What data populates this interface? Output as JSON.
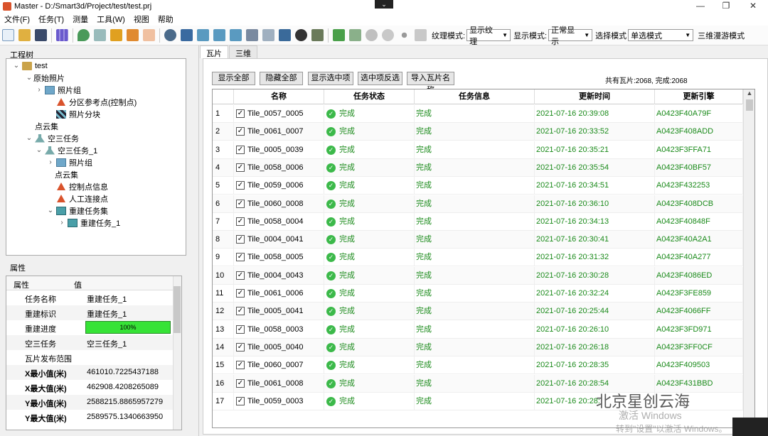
{
  "window": {
    "title": "Master - D:/Smart3d/Project/test/test.prj",
    "dropdown_glyph": "⌄",
    "minimize": "—",
    "maximize": "❐",
    "close": "✕"
  },
  "menubar": [
    "文件(F)",
    "任务(T)",
    "测量",
    "工具(W)",
    "视图",
    "帮助"
  ],
  "toolbar": {
    "texture_label": "纹理模式:",
    "texture_value": "显示纹理",
    "display_label": "显示模式:",
    "display_value": "正常显示",
    "select_label": "选择模式",
    "select_value": "单选模式",
    "roam_label": "三维漫游模式"
  },
  "left": {
    "tree_title": "工程树",
    "tree": [
      {
        "label": "test",
        "icon": "folder-icon",
        "exp": "⌄"
      },
      {
        "label": "原始照片",
        "icon": "",
        "exp": "⌄"
      },
      {
        "label": "照片组",
        "icon": "photo-group-icon",
        "exp": "›"
      },
      {
        "label": "分区参考点(控制点)",
        "icon": "warning-triangle-icon",
        "exp": ""
      },
      {
        "label": "照片分块",
        "icon": "grid-block-icon",
        "exp": ""
      },
      {
        "label": "点云集",
        "icon": "",
        "exp": ""
      },
      {
        "label": "空三任务",
        "icon": "flask-icon",
        "exp": "⌄"
      },
      {
        "label": "空三任务_1",
        "icon": "flask-icon",
        "exp": "⌄"
      },
      {
        "label": "照片组",
        "icon": "photo-group-icon",
        "exp": "›"
      },
      {
        "label": "点云集",
        "icon": "",
        "exp": ""
      },
      {
        "label": "控制点信息",
        "icon": "warning-triangle-icon",
        "exp": ""
      },
      {
        "label": "人工连接点",
        "icon": "warning-triangle-icon",
        "exp": ""
      },
      {
        "label": "重建任务集",
        "icon": "box-icon",
        "exp": "⌄"
      },
      {
        "label": "重建任务_1",
        "icon": "box-icon",
        "exp": "›"
      }
    ],
    "props_title": "属性",
    "props_header": {
      "key": "属性",
      "value": "值"
    },
    "props": [
      {
        "key": "任务名称",
        "value": "重建任务_1",
        "bold": false
      },
      {
        "key": "重建标识",
        "value": "重建任务_1",
        "bold": false
      },
      {
        "key": "重建进度",
        "value": "",
        "bold": false,
        "progress": "100%",
        "progress_fraction": 1.0
      },
      {
        "key": "空三任务",
        "value": "空三任务_1",
        "bold": false
      },
      {
        "key": "瓦片发布范围",
        "value": "",
        "bold": false
      },
      {
        "key": "X最小值(米)",
        "value": "461010.7225437188",
        "bold": true
      },
      {
        "key": "X最大值(米)",
        "value": "462908.4208265089",
        "bold": true
      },
      {
        "key": "Y最小值(米)",
        "value": "2588215.8865957279",
        "bold": true
      },
      {
        "key": "Y最大值(米)",
        "value": "2589575.1340663950",
        "bold": true
      }
    ]
  },
  "right": {
    "tabs": [
      "瓦片",
      "三维"
    ],
    "buttons": [
      "显示全部",
      "隐藏全部",
      "显示选中项",
      "选中项反选",
      "导入瓦片名称"
    ],
    "stats": "共有瓦片:2068, 完成:2068",
    "columns": [
      "",
      "名称",
      "任务状态",
      "任务信息",
      "更新时间",
      "更新引擎"
    ],
    "rows": [
      {
        "n": "1",
        "name": "Tile_0057_0005",
        "status": "完成",
        "info": "完成",
        "time": "2021-07-16 20:39:08",
        "engine": "A0423F40A79F"
      },
      {
        "n": "2",
        "name": "Tile_0061_0007",
        "status": "完成",
        "info": "完成",
        "time": "2021-07-16 20:33:52",
        "engine": "A0423F408ADD"
      },
      {
        "n": "3",
        "name": "Tile_0005_0039",
        "status": "完成",
        "info": "完成",
        "time": "2021-07-16 20:35:21",
        "engine": "A0423F3FFA71"
      },
      {
        "n": "4",
        "name": "Tile_0058_0006",
        "status": "完成",
        "info": "完成",
        "time": "2021-07-16 20:35:54",
        "engine": "A0423F40BF57"
      },
      {
        "n": "5",
        "name": "Tile_0059_0006",
        "status": "完成",
        "info": "完成",
        "time": "2021-07-16 20:34:51",
        "engine": "A0423F432253"
      },
      {
        "n": "6",
        "name": "Tile_0060_0008",
        "status": "完成",
        "info": "完成",
        "time": "2021-07-16 20:36:10",
        "engine": "A0423F408DCB"
      },
      {
        "n": "7",
        "name": "Tile_0058_0004",
        "status": "完成",
        "info": "完成",
        "time": "2021-07-16 20:34:13",
        "engine": "A0423F40848F"
      },
      {
        "n": "8",
        "name": "Tile_0004_0041",
        "status": "完成",
        "info": "完成",
        "time": "2021-07-16 20:30:41",
        "engine": "A0423F40A2A1"
      },
      {
        "n": "9",
        "name": "Tile_0058_0005",
        "status": "完成",
        "info": "完成",
        "time": "2021-07-16 20:31:32",
        "engine": "A0423F40A277"
      },
      {
        "n": "10",
        "name": "Tile_0004_0043",
        "status": "完成",
        "info": "完成",
        "time": "2021-07-16 20:30:28",
        "engine": "A0423F4086ED"
      },
      {
        "n": "11",
        "name": "Tile_0061_0006",
        "status": "完成",
        "info": "完成",
        "time": "2021-07-16 20:32:24",
        "engine": "A0423F3FE859"
      },
      {
        "n": "12",
        "name": "Tile_0005_0041",
        "status": "完成",
        "info": "完成",
        "time": "2021-07-16 20:25:44",
        "engine": "A0423F4066FF"
      },
      {
        "n": "13",
        "name": "Tile_0058_0003",
        "status": "完成",
        "info": "完成",
        "time": "2021-07-16 20:26:10",
        "engine": "A0423F3FD971"
      },
      {
        "n": "14",
        "name": "Tile_0005_0040",
        "status": "完成",
        "info": "完成",
        "time": "2021-07-16 20:26:18",
        "engine": "A0423F3FF0CF"
      },
      {
        "n": "15",
        "name": "Tile_0060_0007",
        "status": "完成",
        "info": "完成",
        "time": "2021-07-16 20:28:35",
        "engine": "A0423F409503"
      },
      {
        "n": "16",
        "name": "Tile_0061_0008",
        "status": "完成",
        "info": "完成",
        "time": "2021-07-16 20:28:54",
        "engine": "A0423F431BBD"
      },
      {
        "n": "17",
        "name": "Tile_0059_0003",
        "status": "完成",
        "info": "完成",
        "time": "2021-07-16 20:28:",
        "engine": ""
      }
    ]
  },
  "overlay": {
    "watermark": "北京星创云海",
    "activate1": "激活 Windows",
    "activate2": "转到\"设置\"以激活 Windows。"
  },
  "colors": {
    "accent_green": "#3cb94a",
    "progress_green": "#36e336",
    "folder": "#caa34a",
    "warning": "#d9532c"
  }
}
